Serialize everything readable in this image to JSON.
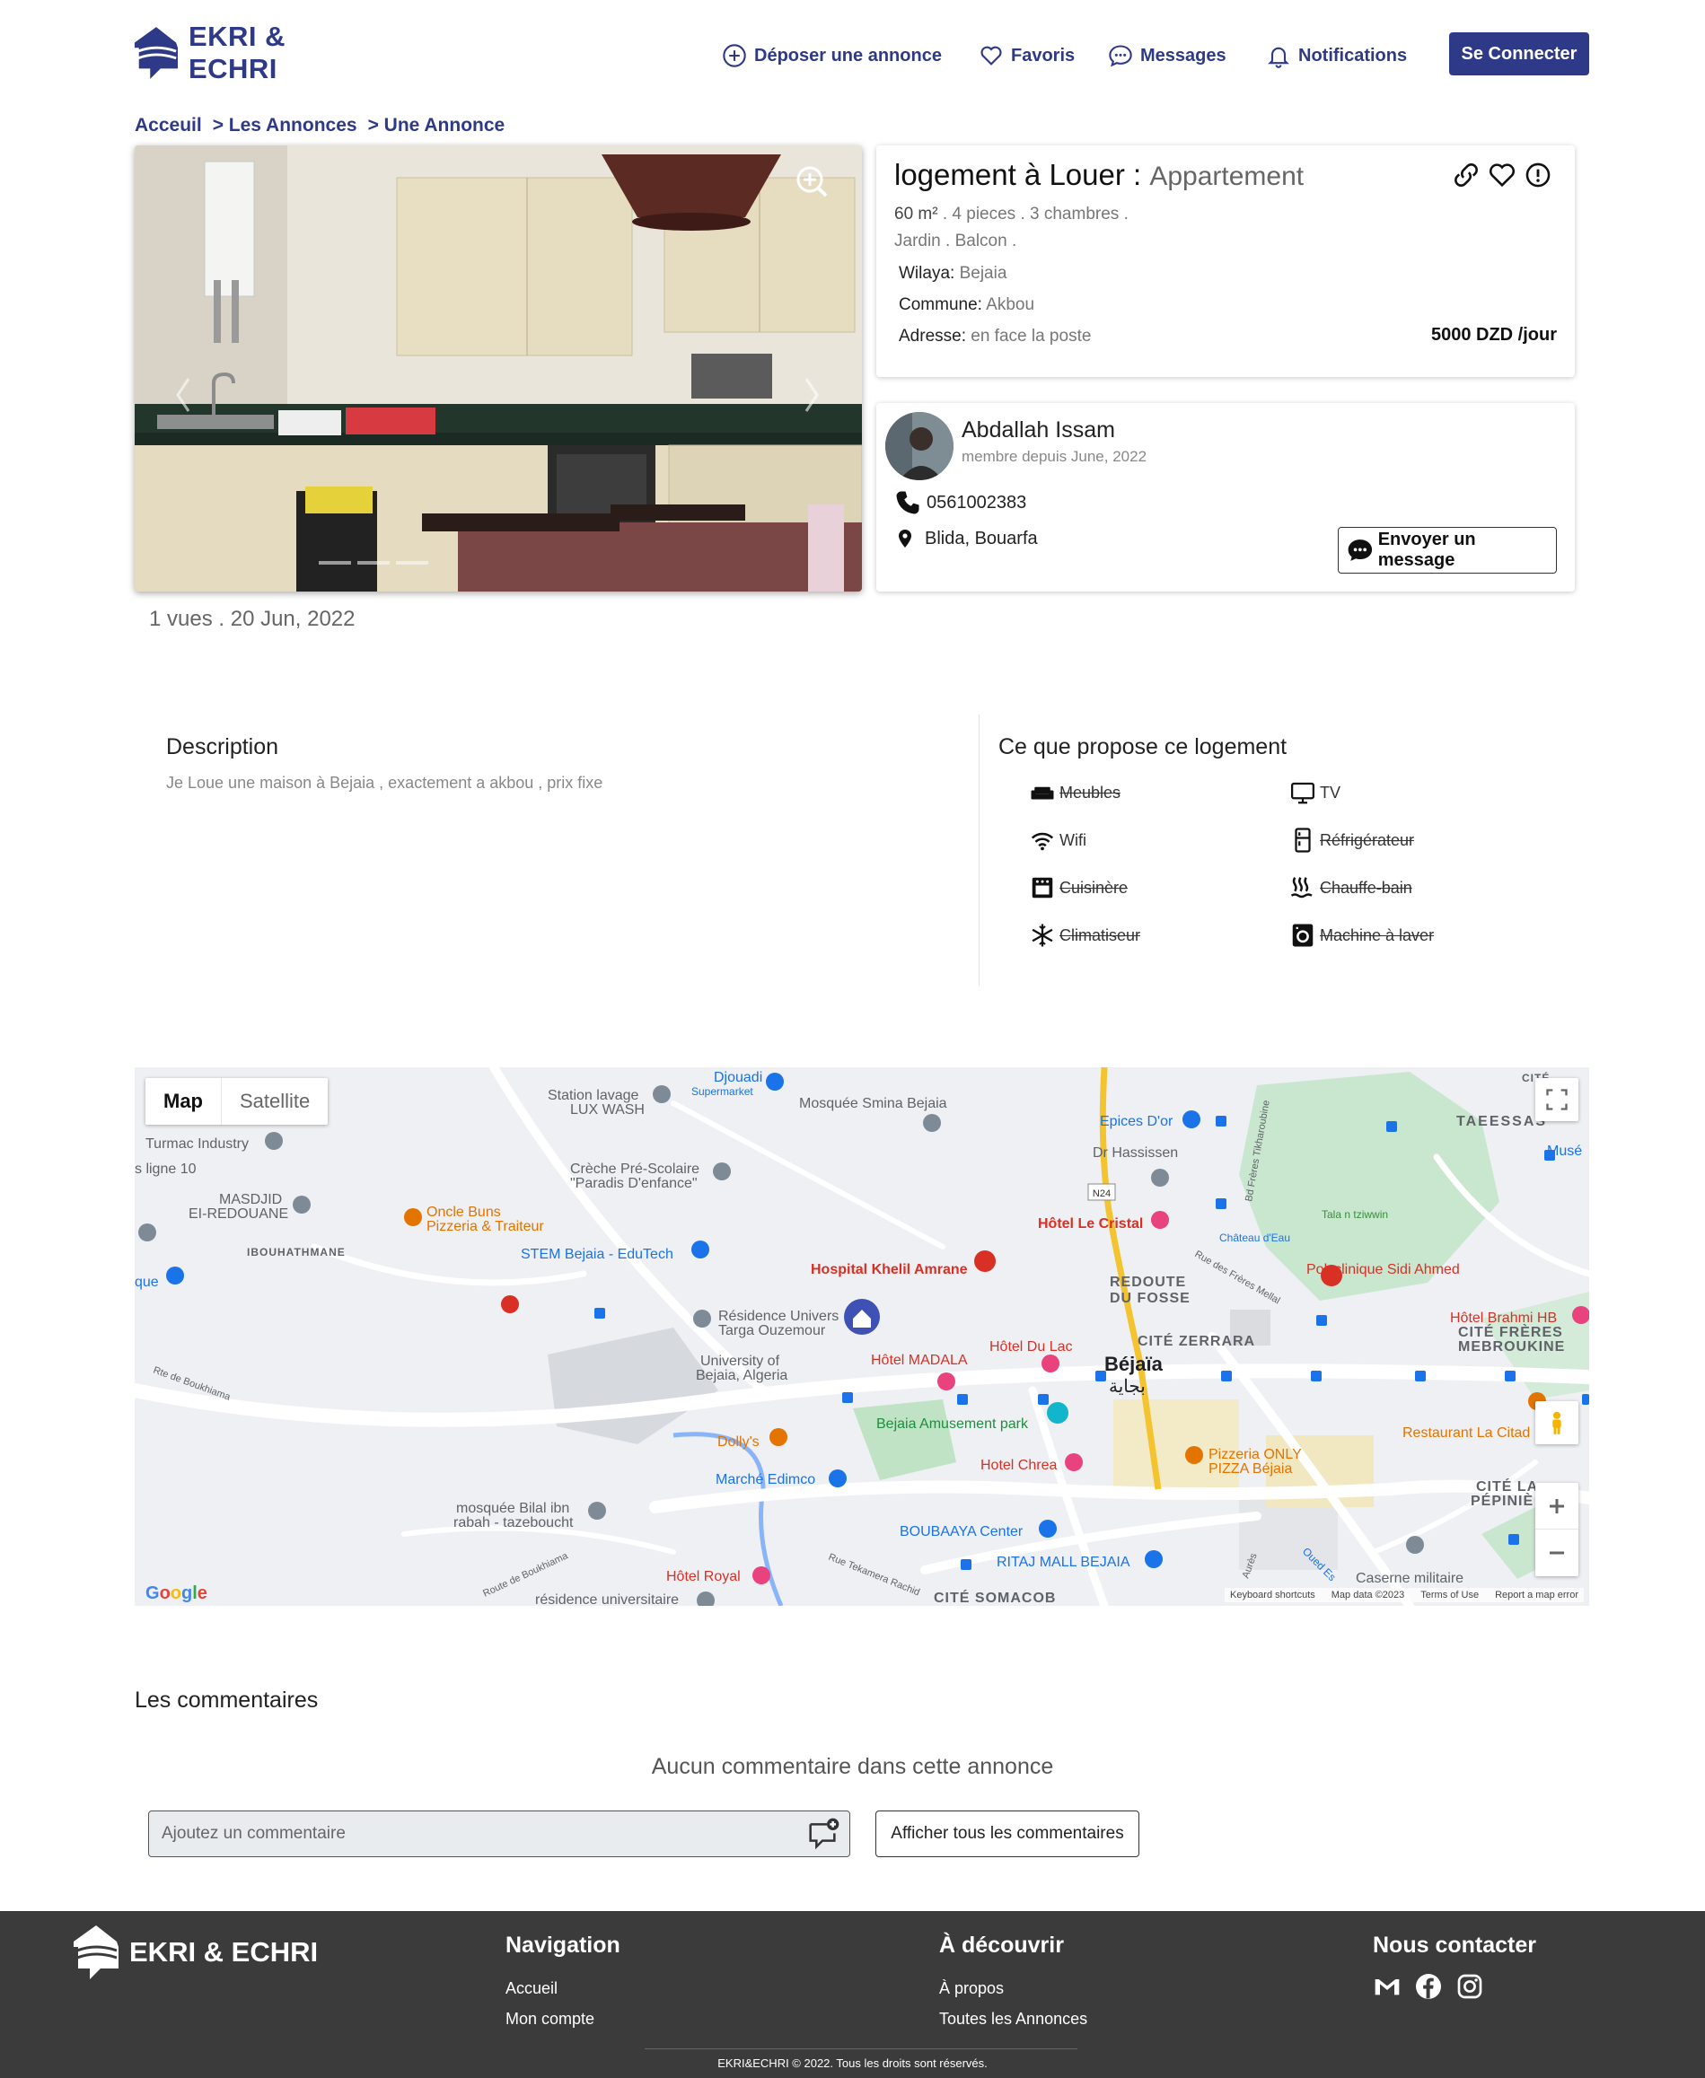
{
  "brand": {
    "name": "EKRI & ECHRI",
    "color": "#2e3a87"
  },
  "header": {
    "nav": [
      {
        "label": "Déposer une annonce",
        "icon": "plus-circle-icon"
      },
      {
        "label": "Favoris",
        "icon": "heart-icon"
      },
      {
        "label": "Messages",
        "icon": "chat-icon"
      },
      {
        "label": "Notifications",
        "icon": "bell-icon"
      }
    ],
    "login_label": "Se Connecter"
  },
  "breadcrumb": [
    "Acceuil",
    "> Les Annonces",
    "> Une Annonce"
  ],
  "listing": {
    "title": "logement à Louer :",
    "property_type": "Appartement",
    "area": "60 m²",
    "details": ". 4 pieces . 3 chambres .",
    "extras": "Jardin . Balcon .",
    "wilaya_label": "Wilaya:",
    "wilaya": "Bejaia",
    "commune_label": "Commune:",
    "commune": "Akbou",
    "address_label": "Adresse:",
    "address": "en face la poste",
    "price": "5000 DZD /jour",
    "views_date": "1 vues . 20 Jun, 2022"
  },
  "owner": {
    "name": "Abdallah Issam",
    "since": "membre depuis June, 2022",
    "phone": "0561002383",
    "location": "Blida, Bouarfa",
    "message_label": "Envoyer un message"
  },
  "description": {
    "title": "Description",
    "text": "Je Loue une maison à Bejaia , exactement a akbou , prix fixe"
  },
  "equipment": {
    "title": "Ce que propose ce logement",
    "items": [
      {
        "label": "Meubles",
        "available": false,
        "icon": "sofa-icon"
      },
      {
        "label": "TV",
        "available": true,
        "icon": "tv-icon"
      },
      {
        "label": "Wifi",
        "available": true,
        "icon": "wifi-icon"
      },
      {
        "label": "Réfrigérateur",
        "available": false,
        "icon": "fridge-icon"
      },
      {
        "label": "Cuisinère",
        "available": false,
        "icon": "stove-icon"
      },
      {
        "label": "Chauffe-bain",
        "available": false,
        "icon": "heater-icon"
      },
      {
        "label": "Climatiseur",
        "available": false,
        "icon": "snowflake-icon"
      },
      {
        "label": "Machine à laver",
        "available": false,
        "icon": "washing-machine-icon"
      }
    ]
  },
  "map": {
    "type_map": "Map",
    "type_satellite": "Satellite",
    "footer": [
      "Keyboard shortcuts",
      "Map data ©2023",
      "Terms of Use",
      "Report a map error"
    ],
    "google": "Google",
    "places": [
      "Djouadi",
      "Supermarket",
      "Station lavage",
      "LUX WASH",
      "Mosquée Smina Bejaia",
      "Epices D'or",
      "Dr Hassissen",
      "TAEESSAS",
      "Musé",
      "Turmac Industry",
      "s ligne 10",
      "Crèche Pré-Scolaire",
      "\"Paradis D'enfance\"",
      "MASDJID",
      "EI-REDOUANE",
      "Oncle Buns",
      "Pizzeria & Traiteur",
      "Hôtel Le Cristal",
      "Tala n tziwwin",
      "IBOUHATHMANE",
      "STEM Bejaia - EduTech",
      "Hospital Khelil Amrane",
      "Polyclinique Sidi Ahmed",
      "Château d'Eau",
      "que",
      "REDOUTE",
      "DU FOSSE",
      "Hôtel Brahmi HB",
      "CITÉ FRÈRES",
      "MEBROUKINE",
      "Résidence Univers",
      "Targa Ouzemour",
      "CITÉ ZERRARA",
      "Hôtel Du Lac",
      "University of",
      "Bejaia, Algeria",
      "Hôtel MADALA",
      "Béjaïa",
      "بجاية",
      "Rte de Boukhiama",
      "Bejaia Amusement park",
      "Restaurant La Citad",
      "Dolly's",
      "Pizzeria ONLY",
      "PIZZA Béjaia",
      "Hotel Chrea",
      "Marché Edimco",
      "CITÉ LA",
      "PÉPINIÈ",
      "mosquée Bilal ibn",
      "rabah - tazeboucht",
      "BOUBAAYA Center",
      "RITAJ MALL BEJAIA",
      "Caserne militaire",
      "Hôtel Royal",
      "résidence universitaire",
      "CITÉ SOMACOB",
      "Rue des Frères Mellal",
      "Bd Frères Tikharoubine",
      "N24",
      "Rue Tekamera Rachid",
      "Route de Boukhiama",
      "Oued Es",
      "Aurès",
      "CITÉ"
    ]
  },
  "comments": {
    "title": "Les commentaires",
    "empty": "Aucun commentaire dans cette annonce",
    "placeholder": "Ajoutez un commentaire",
    "show_all": "Afficher tous les commentaires"
  },
  "footer": {
    "brand": "EKRI & ECHRI",
    "nav_title": "Navigation",
    "nav_links": [
      "Accueil",
      "Mon compte"
    ],
    "discover_title": "À découvrir",
    "discover_links": [
      "À propos",
      "Toutes les Annonces"
    ],
    "contact_title": "Nous contacter",
    "social_icons": [
      "gmail-icon",
      "facebook-icon",
      "instagram-icon"
    ],
    "copyright": "EKRI&ECHRI © 2022. Tous les droits sont réservés."
  }
}
